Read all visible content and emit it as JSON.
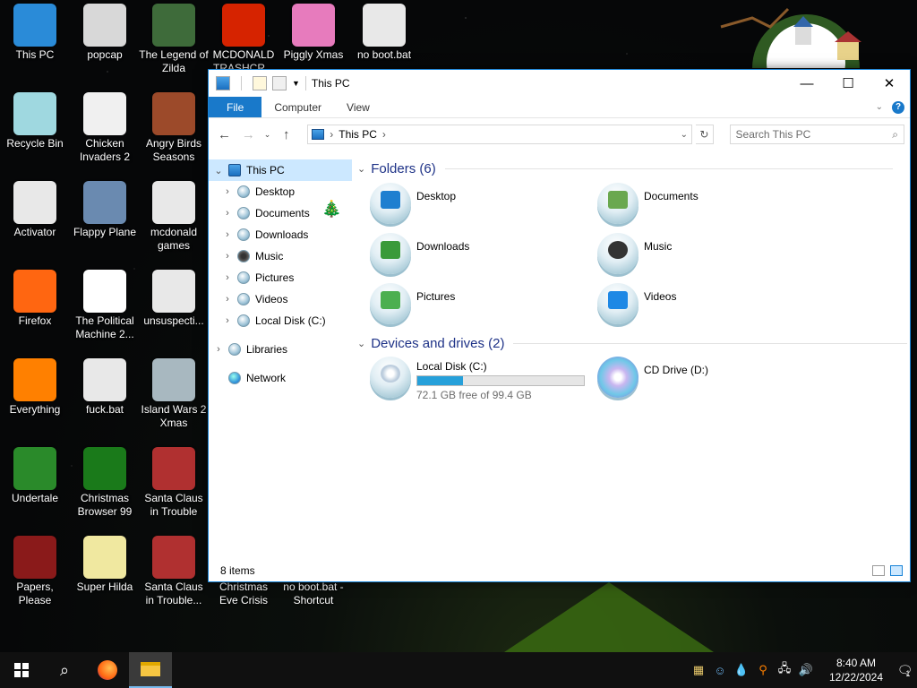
{
  "desktop": {
    "icons": [
      {
        "label": "This PC",
        "icon": "this-pc-icon",
        "color": "#2a8bd8"
      },
      {
        "label": "popcap",
        "icon": "popcap-folder-icon",
        "color": "#d8d8d8"
      },
      {
        "label": "The Legend of Zilda",
        "icon": "game-shortcut-icon",
        "color": "#3e6b3a"
      },
      {
        "label": "MCDONALD TRASHCR...",
        "icon": "mcdonalds-icon",
        "color": "#d62300"
      },
      {
        "label": "Piggly Xmas",
        "icon": "pig-icon",
        "color": "#e77bbd"
      },
      {
        "label": "no boot.bat",
        "icon": "batch-file-icon",
        "color": "#e8e8e8"
      },
      {
        "label": "Recycle Bin",
        "icon": "recycle-bin-icon",
        "color": "#9fd8e0"
      },
      {
        "label": "Chicken Invaders 2",
        "icon": "chicken-icon",
        "color": "#f0f0f0"
      },
      {
        "label": "Angry Birds Seasons",
        "icon": "angry-birds-icon",
        "color": "#9c4a2a"
      },
      {
        "label": "Activator",
        "icon": "folder-icon",
        "color": "#e8e8e8"
      },
      {
        "label": "Flappy Plane",
        "icon": "flappy-plane-icon",
        "color": "#6a8ab0"
      },
      {
        "label": "mcdonald games",
        "icon": "folder-icon",
        "color": "#e8e8e8"
      },
      {
        "label": "Firefox",
        "icon": "firefox-icon",
        "color": "#ff6611"
      },
      {
        "label": "The Political Machine 2...",
        "icon": "political-machine-icon",
        "color": "#ffffff"
      },
      {
        "label": "unsuspecti...",
        "icon": "folder-icon",
        "color": "#e8e8e8"
      },
      {
        "label": "Everything",
        "icon": "everything-search-icon",
        "color": "#ff8000"
      },
      {
        "label": "fuck.bat",
        "icon": "batch-file-icon",
        "color": "#e8e8e8"
      },
      {
        "label": "Island Wars 2 Xmas",
        "icon": "island-wars-icon",
        "color": "#a8b8c0"
      },
      {
        "label": "Undertale",
        "icon": "undertale-icon",
        "color": "#2a8a2a"
      },
      {
        "label": "Christmas Browser 99",
        "icon": "xmas-tree-icon",
        "color": "#1a7a1a"
      },
      {
        "label": "Santa Claus in Trouble",
        "icon": "santa-icon",
        "color": "#b03030"
      },
      {
        "label": "Papers, Please",
        "icon": "papers-please-icon",
        "color": "#8a1a1a"
      },
      {
        "label": "Super Hilda",
        "icon": "super-hilda-icon",
        "color": "#f0e8a0"
      },
      {
        "label": "Santa Claus in Trouble... A...",
        "icon": "santa-icon",
        "color": "#b03030"
      },
      {
        "label": "Christmas Eve Crisis",
        "icon": "",
        "color": ""
      },
      {
        "label": "no boot.bat - Shortcut",
        "icon": "",
        "color": ""
      }
    ]
  },
  "window": {
    "title": "This PC",
    "controls": {
      "minimize": "—",
      "maximize": "☐",
      "close": "✕"
    }
  },
  "ribbon": {
    "tabs": [
      "File",
      "Computer",
      "View"
    ]
  },
  "address": {
    "crumb": "This PC",
    "search_placeholder": "Search This PC"
  },
  "nav": {
    "items": [
      {
        "label": "This PC",
        "icon": "this-pc-icon",
        "selected": true,
        "expanded": true
      },
      {
        "label": "Desktop",
        "icon": "desktop-icon"
      },
      {
        "label": "Documents",
        "icon": "documents-icon"
      },
      {
        "label": "Downloads",
        "icon": "downloads-icon"
      },
      {
        "label": "Music",
        "icon": "music-icon"
      },
      {
        "label": "Pictures",
        "icon": "pictures-icon"
      },
      {
        "label": "Videos",
        "icon": "videos-icon"
      },
      {
        "label": "Local Disk (C:)",
        "icon": "local-disk-icon"
      },
      {
        "label": "Libraries",
        "icon": "libraries-icon"
      },
      {
        "label": "Network",
        "icon": "network-icon"
      }
    ]
  },
  "content": {
    "folders_header": "Folders (6)",
    "folders": [
      {
        "label": "Desktop",
        "icon": "desktop-folder-icon",
        "color": "#1e7fd0"
      },
      {
        "label": "Documents",
        "icon": "documents-folder-icon",
        "color": "#6aa84f"
      },
      {
        "label": "Downloads",
        "icon": "downloads-folder-icon",
        "color": "#3a9a3a"
      },
      {
        "label": "Music",
        "icon": "music-folder-icon",
        "color": "#333333"
      },
      {
        "label": "Pictures",
        "icon": "pictures-folder-icon",
        "color": "#4caf50"
      },
      {
        "label": "Videos",
        "icon": "videos-folder-icon",
        "color": "#1e88e5"
      }
    ],
    "drives_header": "Devices and drives (2)",
    "drives": [
      {
        "label": "Local Disk (C:)",
        "icon": "local-disk-icon",
        "free_text": "72.1 GB free of 99.4 GB",
        "used_fraction": 0.275
      },
      {
        "label": "CD Drive (D:)",
        "icon": "cd-drive-icon"
      }
    ]
  },
  "status": {
    "items_count": "8 items"
  },
  "taskbar": {
    "time": "8:40 AM",
    "date": "12/22/2024",
    "notification_count": "1"
  }
}
